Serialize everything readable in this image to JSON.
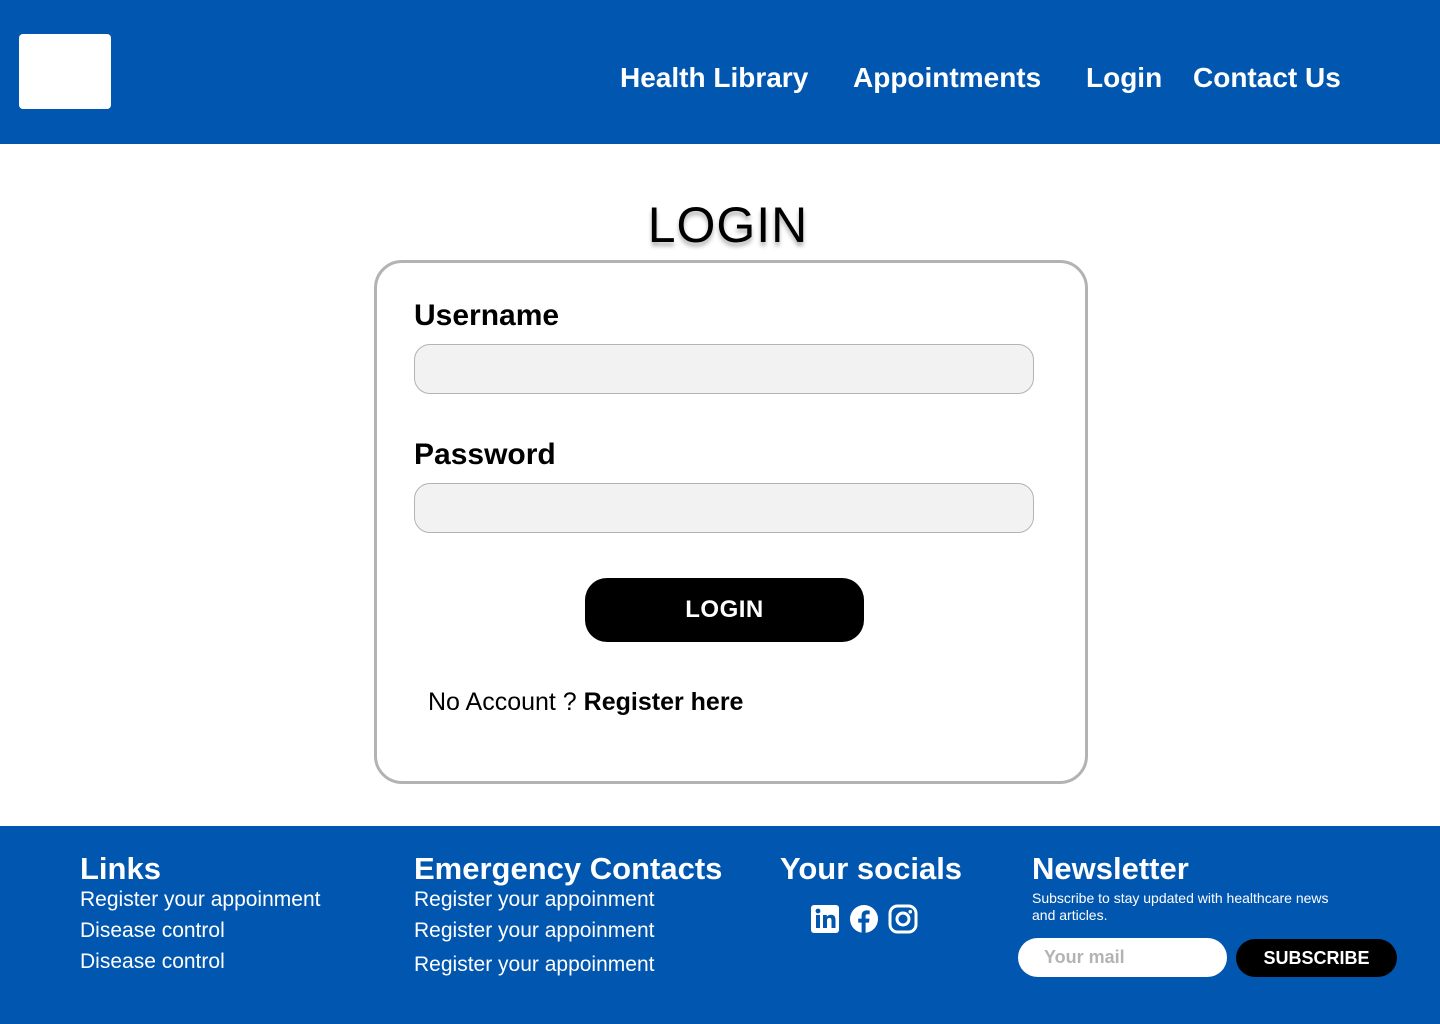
{
  "header": {
    "nav": [
      {
        "label": "Health Library"
      },
      {
        "label": "Appointments"
      },
      {
        "label": "Login"
      },
      {
        "label": "Contact Us"
      }
    ],
    "background_color": "#0156B0"
  },
  "main": {
    "title": "LOGIN",
    "username_label": "Username",
    "username_value": "",
    "password_label": "Password",
    "password_value": "",
    "login_button": "LOGIN",
    "no_account_text": "No Account ?",
    "register_link": "Register here"
  },
  "footer": {
    "links": {
      "heading": "Links",
      "items": [
        "Register your appoinment",
        "Disease control",
        "Disease control"
      ]
    },
    "emergency": {
      "heading": "Emergency Contacts",
      "items": [
        "Register your appoinment",
        "Register your appoinment",
        "Register your appoinment"
      ]
    },
    "socials": {
      "heading": "Your socials",
      "icons": [
        "linkedin-icon",
        "facebook-icon",
        "instagram-icon"
      ]
    },
    "newsletter": {
      "heading": "Newsletter",
      "description": "Subscribe to stay updated with healthcare news and articles.",
      "mail_placeholder": "Your mail",
      "subscribe_button": "SUBSCRIBE"
    }
  }
}
